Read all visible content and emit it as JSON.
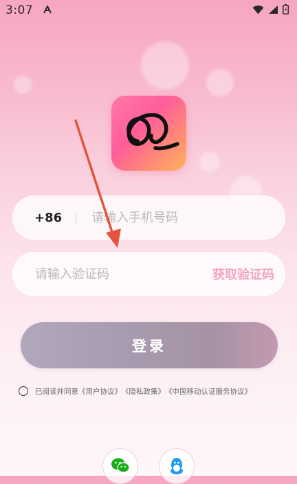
{
  "status_bar": {
    "time": "3:07"
  },
  "icons": {
    "status_app": "a-icon",
    "wifi": "wifi-icon",
    "signal": "signal-icon",
    "battery": "battery-icon",
    "logo": "loop-logo-icon",
    "wechat": "wechat-icon",
    "qq": "qq-penguin-icon"
  },
  "login": {
    "country_code": "+86",
    "phone_placeholder": "请输入手机号码",
    "code_placeholder": "请输入验证码",
    "get_code_label": "获取验证码",
    "login_label": "登录"
  },
  "agreement": {
    "prefix": "已阅读并同意",
    "user_agreement": "《用户协议》",
    "privacy_policy": "《隐私政策》",
    "cmcc_agreement": "《中国移动认证服务协议》"
  },
  "colors": {
    "get_code": "#f3a6bf",
    "annotation_arrow": "#e5533a",
    "logo_gradient_start": "#ff5d9a",
    "logo_gradient_end": "#ffb25a"
  }
}
